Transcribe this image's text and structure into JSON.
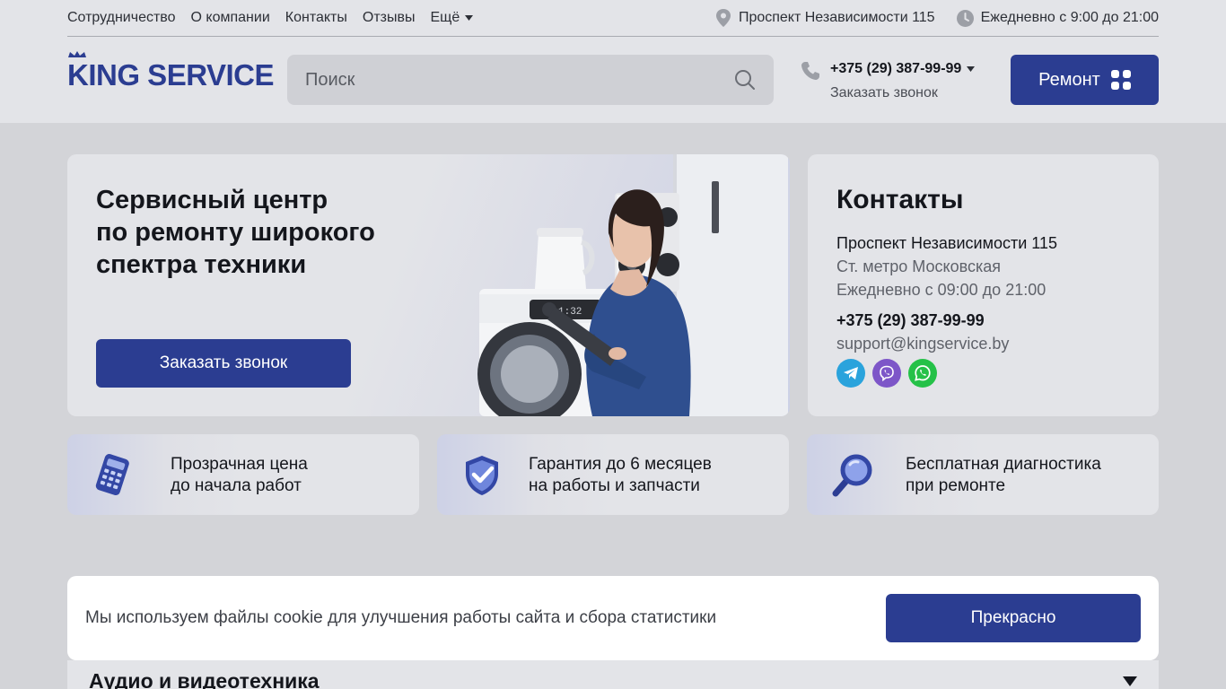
{
  "topnav": {
    "items": [
      "Сотрудничество",
      "О компании",
      "Контакты",
      "Отзывы"
    ],
    "more_label": "Ещё"
  },
  "topinfo": {
    "address": "Проспект Независимости 115",
    "hours": "Ежедневно с 9:00 до 21:00"
  },
  "logo": {
    "text_rest": "ING SERVICE",
    "text_first": "K"
  },
  "search": {
    "placeholder": "Поиск"
  },
  "phone": {
    "number": "+375 (29) 387-99-99",
    "callback": "Заказать звонок"
  },
  "repair_button": {
    "label": "Ремонт"
  },
  "hero": {
    "title_line1": "Сервисный центр",
    "title_line2": "по ремонту широкого",
    "title_line3": "спектра техники",
    "cta": "Заказать звонок",
    "display_readout": "1:32"
  },
  "contacts": {
    "title": "Контакты",
    "address": "Проспект Независимости 115",
    "metro": "Ст. метро Московская",
    "hours": "Ежедневно с 09:00 до 21:00",
    "phone": "+375 (29) 387-99-99",
    "email": "support@kingservice.by",
    "socials": [
      "telegram-icon",
      "viber-icon",
      "whatsapp-icon"
    ]
  },
  "features": [
    {
      "line1": "Прозрачная цена",
      "line2": "до начала работ",
      "icon": "calculator-icon"
    },
    {
      "line1": "Гарантия до 6 месяцев",
      "line2": "на работы и запчасти",
      "icon": "shield-check-icon"
    },
    {
      "line1": "Бесплатная диагностика",
      "line2": "при ремонте",
      "icon": "magnifier-icon"
    }
  ],
  "cookie": {
    "message": "Мы используем файлы cookie для улучшения работы сайта и сбора статистики",
    "accept": "Прекрасно"
  },
  "accordion": {
    "title": "Аудио и видеотехника"
  },
  "colors": {
    "brand": "#2b3d91",
    "background": "#d3d4d8",
    "card": "#e3e4e8",
    "telegram": "#2aa3dc",
    "viber": "#7d56c8",
    "whatsapp": "#25c148"
  }
}
